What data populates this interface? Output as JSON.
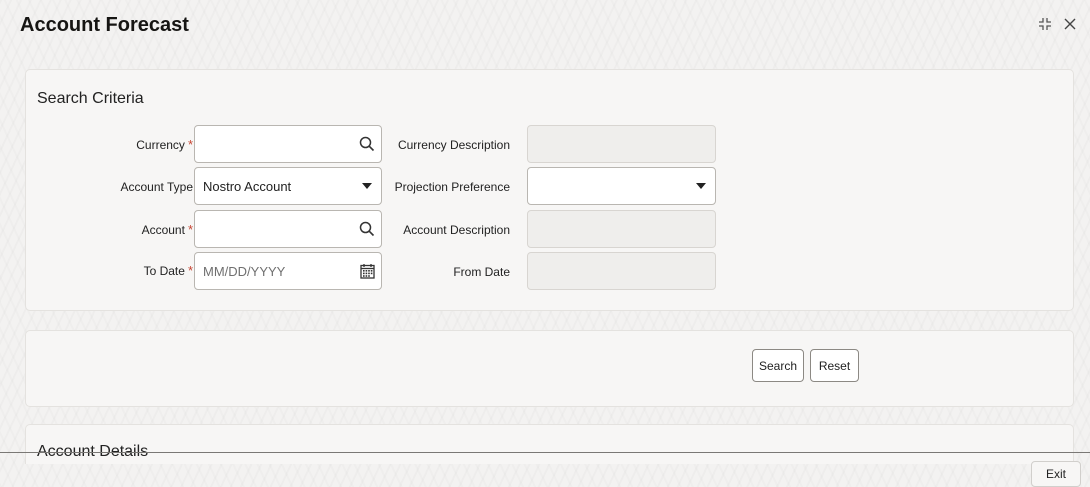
{
  "window": {
    "title": "Account Forecast",
    "expand_icon": "expand-icon",
    "close_icon": "close-icon"
  },
  "search_criteria": {
    "title": "Search Criteria",
    "required_marker": "*",
    "fields": {
      "currency": {
        "label": "Currency",
        "value": "",
        "required": true,
        "icon": "search-icon"
      },
      "currency_description": {
        "label": "Currency Description",
        "value": ""
      },
      "account_type": {
        "label": "Account Type",
        "value": "Nostro Account",
        "icon": "chevron-down-icon"
      },
      "projection_preference": {
        "label": "Projection Preference",
        "value": "",
        "icon": "chevron-down-icon"
      },
      "account": {
        "label": "Account",
        "value": "",
        "required": true,
        "icon": "search-icon"
      },
      "account_description": {
        "label": "Account Description",
        "value": ""
      },
      "to_date": {
        "label": "To Date",
        "placeholder": "MM/DD/YYYY",
        "value": "",
        "required": true,
        "icon": "calendar-icon"
      },
      "from_date": {
        "label": "From Date",
        "value": ""
      }
    }
  },
  "actions": {
    "search_label": "Search",
    "reset_label": "Reset"
  },
  "account_details": {
    "title": "Account Details"
  },
  "footer": {
    "exit_label": "Exit"
  },
  "colors": {
    "required": "#c74634",
    "background": "#f3f2f1",
    "panel": "#f7f6f5",
    "readonly_field": "#efeeec"
  }
}
